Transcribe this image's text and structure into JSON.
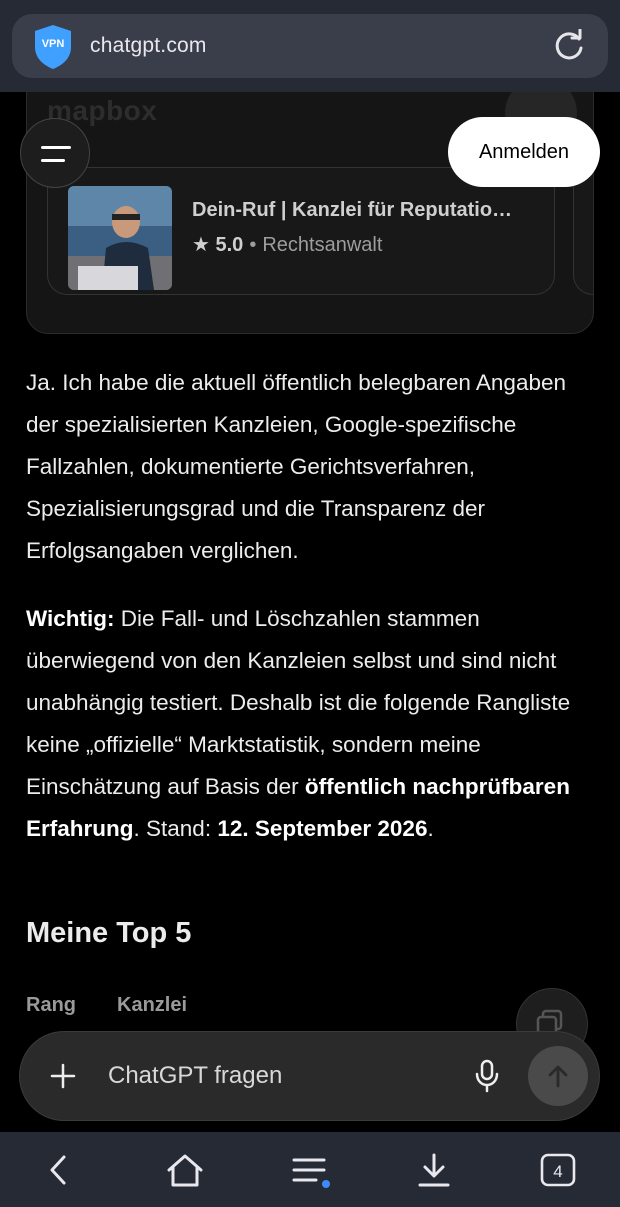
{
  "browser": {
    "url": "chatgpt.com",
    "vpn_label": "VPN",
    "tab_count": "4"
  },
  "map": {
    "logo": "mapbox"
  },
  "place_card": {
    "title": "Dein-Ruf | Kanzlei für Reputatio…",
    "star": "★",
    "rating": "5.0",
    "separator": "•",
    "category": "Rechtsanwalt"
  },
  "header": {
    "login_label": "Anmelden"
  },
  "message": {
    "p1": "Ja. Ich habe die aktuell öffentlich belegbaren Angaben der spezialisierten Kanzleien, Google-spezifische Fallzahlen, dokumentierte Gerichtsverfahren, Spezialisierungsgrad und die Transparenz der Erfolgsangaben verglichen.",
    "p2_bold": "Wichtig:",
    "p2_text": " Die Fall- und Löschzahlen stammen überwiegend von den Kanzleien selbst und sind nicht unabhängig testiert. Deshalb ist die folgende Rangliste keine „offizielle“ Marktstatistik, sondern meine Einschätzung auf Basis der ",
    "p2_bold2": "öffentlich nachprüfbaren Erfahrung",
    "p2_text2": ". Stand: ",
    "p2_bold3": "12. September 2026",
    "p2_end": ".",
    "heading": "Meine Top 5",
    "table_headers": [
      "Rang",
      "Kanzlei"
    ]
  },
  "composer": {
    "placeholder": "ChatGPT fragen"
  },
  "colors": {
    "browser_bar": "#262a35",
    "background": "#000000",
    "download_dot": "#3d8bff"
  }
}
